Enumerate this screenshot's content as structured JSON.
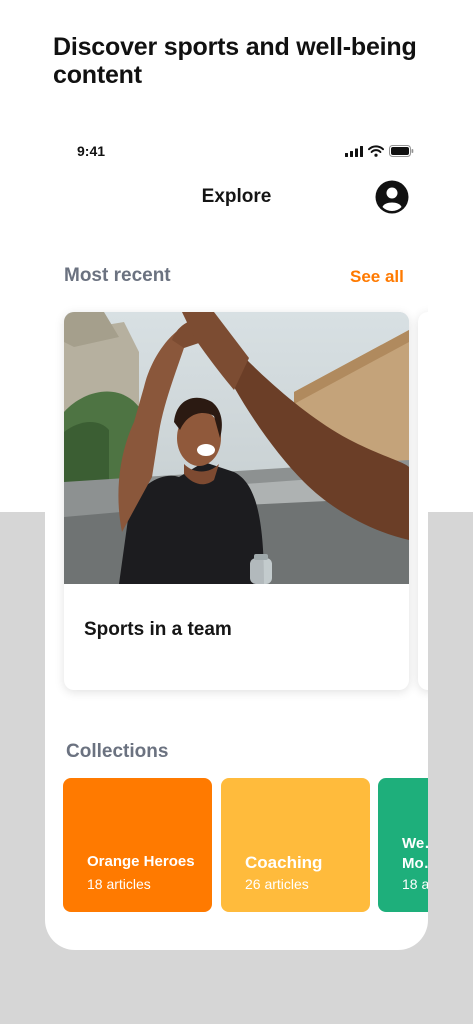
{
  "headline": "Discover sports and well-being content",
  "status_bar": {
    "time": "9:41",
    "icons": [
      "cellular-signal-icon",
      "wifi-icon",
      "battery-icon"
    ]
  },
  "nav": {
    "title": "Explore",
    "profile_icon": "profile-icon"
  },
  "most_recent": {
    "title": "Most recent",
    "see_all_label": "See all",
    "cards": [
      {
        "title": "Sports in a team",
        "image": "two people high-fiving outdoors"
      }
    ]
  },
  "collections": {
    "title": "Collections",
    "items": [
      {
        "title": "Orange Heroes",
        "count": "18 articles",
        "color": "#ff7a00"
      },
      {
        "title": "Coaching",
        "count": "26 articles",
        "color": "#ffbb3c"
      },
      {
        "title": "We…",
        "title_line2": "Mo…",
        "count": "18 a…",
        "color": "#1eaf7b"
      }
    ]
  },
  "colors": {
    "accent": "#ff7a00",
    "section_title": "#6b7280",
    "background_lower": "#d6d6d6"
  }
}
